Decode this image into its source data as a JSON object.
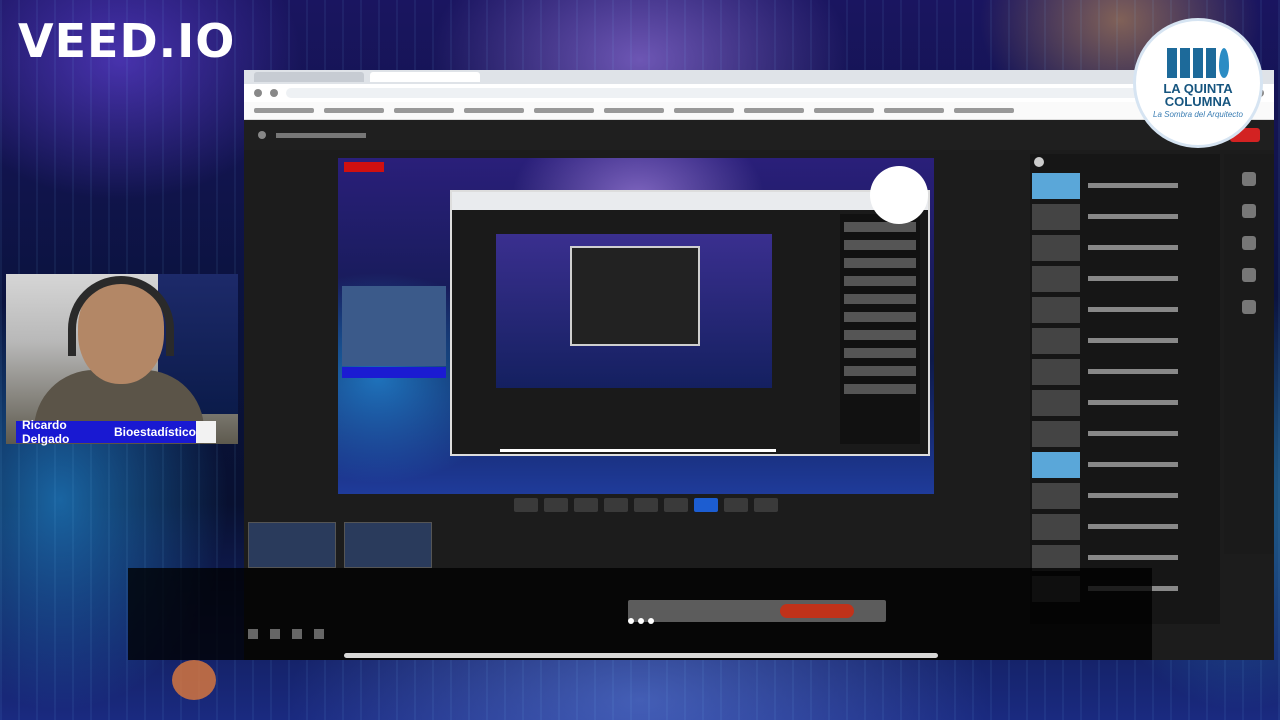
{
  "watermark": {
    "brand": "VEED.IO",
    "icon": "veed-wordmark"
  },
  "channel_logo": {
    "name_line1": "LA QUINTA",
    "name_line2": "COLUMNA",
    "tagline": "La Sombra del Arquitecto",
    "icon": "columns-logo-icon"
  },
  "presenter": {
    "name": "Ricardo Delgado",
    "role": "Bioestadístico"
  },
  "colors": {
    "label_bg": "#1919d2",
    "live_red": "#d32222",
    "brand_blue": "#16557f"
  },
  "icons": {
    "veed": "veed-wordmark",
    "logo": "columns-logo-icon",
    "loading": "loading-dots-icon"
  }
}
